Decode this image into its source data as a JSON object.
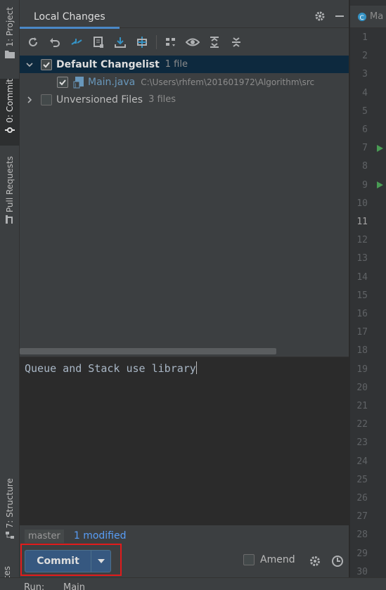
{
  "left_stripe": {
    "project_label": "1: Project",
    "commit_label": "0: Commit",
    "pull_requests_label": "Pull Requests",
    "structure_label": "7: Structure",
    "favorites_label": "orites"
  },
  "commit_panel": {
    "tab_label": "Local Changes",
    "tree": {
      "default_changelist": {
        "label": "Default Changelist",
        "count": "1 file",
        "checked": true
      },
      "file": {
        "name": "Main.java",
        "path": "C:\\Users\\rhfem\\201601972\\Algorithm\\src",
        "checked": true
      },
      "unversioned": {
        "label": "Unversioned Files",
        "count": "3 files",
        "checked": false
      }
    },
    "commit_message": "Queue and Stack use library",
    "branch": "master",
    "modified_text": "1 modified",
    "commit_button_label": "Commit",
    "amend_label": "Amend",
    "amend_checked": false
  },
  "bottom_bar": {
    "run_label": "Run:",
    "main_tab_label": "Main"
  },
  "editor": {
    "tab_label": "Ma",
    "line_numbers": [
      "1",
      "2",
      "3",
      "4",
      "5",
      "6",
      "7",
      "8",
      "9",
      "10",
      "11",
      "12",
      "13",
      "14",
      "15",
      "16",
      "17",
      "18",
      "19",
      "20",
      "21",
      "22",
      "23",
      "24",
      "25",
      "26",
      "27",
      "28",
      "29",
      "30"
    ],
    "current_line": "11"
  },
  "colors": {
    "accent": "#4a88c7",
    "selection": "#0d293e",
    "commit_button": "#365880",
    "highlight_box": "#e21b1b",
    "run_marker": "#499c54"
  }
}
